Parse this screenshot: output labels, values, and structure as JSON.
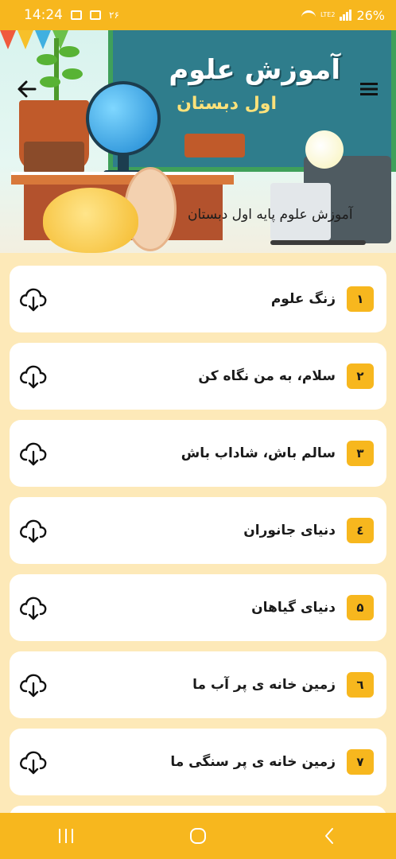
{
  "status_bar": {
    "time": "14:24",
    "notification_count": "۲۶",
    "battery": "26%",
    "network": "LTE2"
  },
  "banner": {
    "title": "آموزش علوم",
    "subtitle": "اول دبستان",
    "caption": "آموزش علوم پایه اول دبستان"
  },
  "lessons": [
    {
      "number": "۱",
      "title": "زنگ علوم"
    },
    {
      "number": "۲",
      "title": "سلام، به من نگاه کن"
    },
    {
      "number": "۳",
      "title": "سالم باش، شاداب باش"
    },
    {
      "number": "٤",
      "title": "دنیای جانوران"
    },
    {
      "number": "۵",
      "title": "دنیای گیاهان"
    },
    {
      "number": "٦",
      "title": "زمین خانه ی پر آب ما"
    },
    {
      "number": "۷",
      "title": "زمین خانه ی پر سنگی ما"
    }
  ],
  "colors": {
    "accent": "#f7b71e",
    "page_background": "#fde9b8",
    "card": "#ffffff",
    "text": "#1a1a1a"
  },
  "icons": {
    "download": "cloud-download-icon",
    "back": "arrow-left-icon",
    "menu": "hamburger-menu-icon"
  }
}
